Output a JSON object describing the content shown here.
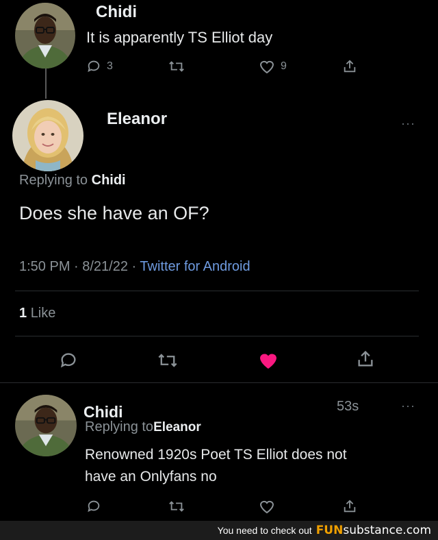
{
  "tweet1": {
    "name": "Chidi",
    "text": "It is apparently TS Elliot day",
    "reply_count": "3",
    "like_count": "9"
  },
  "tweet2": {
    "name": "Eleanor",
    "more": "···",
    "replying_prefix": "Replying to",
    "replying_to": "Chidi",
    "text": "Does she have an OF?",
    "time_date": "1:50 PM · 8/21/22 · ",
    "source": "Twitter for Android",
    "likes_count": "1",
    "likes_label": "Like",
    "liked": true,
    "like_color": "#f91880"
  },
  "tweet3": {
    "name": "Chidi",
    "age": "53s",
    "more": "···",
    "replying_prefix": "Replying to",
    "replying_to": "Eleanor",
    "text_line1": "Renowned 1920s Poet TS Elliot does not",
    "text_line2": "have an Onlyfans no"
  },
  "footer": {
    "text": "You need to check out",
    "brand_bold": "FUN",
    "brand_rest": "substance.com"
  },
  "colors": {
    "link": "#6f9be0",
    "muted": "#8b9297",
    "background": "#000000"
  }
}
